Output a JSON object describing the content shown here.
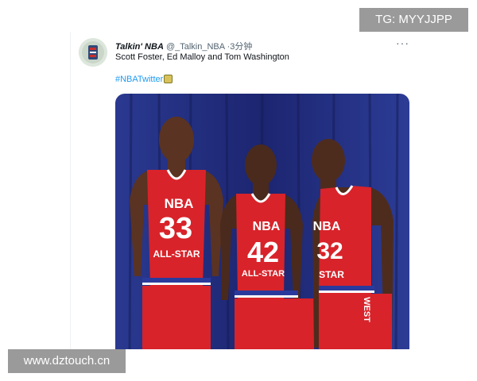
{
  "watermarks": {
    "top_right": "TG: MYYJJPP",
    "bottom_left": "www.dztouch.cn"
  },
  "tweet": {
    "display_name": "Talkin' NBA",
    "handle": "@_Talkin_NBA",
    "separator": "·",
    "time": "3分钟",
    "more": "···",
    "text": "Scott Foster, Ed Malloy and Tom Washington",
    "hashtag": "#NBATwitter",
    "avatar_icon": "talkin-nba-logo"
  },
  "media": {
    "jerseys": [
      {
        "logo": "NBA",
        "number": "33",
        "caption": "ALL-STAR"
      },
      {
        "logo": "NBA",
        "number": "42",
        "caption": "ALL-STAR"
      },
      {
        "logo": "NBA",
        "number": "32",
        "caption": "STAR",
        "side": "WEST"
      }
    ],
    "colors": {
      "curtain": "#1e2a78",
      "jersey": "#d8232a",
      "trim": "#ffffff",
      "stripe": "#2a3a9c"
    }
  }
}
